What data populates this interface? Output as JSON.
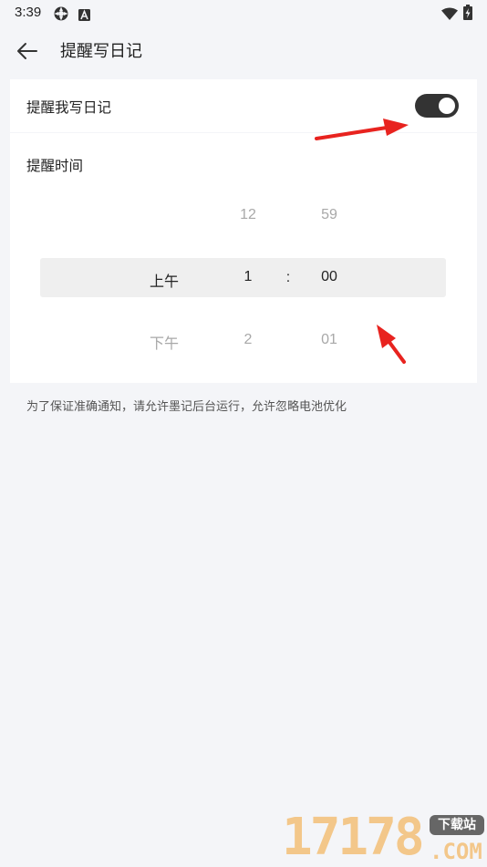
{
  "status_bar": {
    "time": "3:39",
    "icons": [
      "settings-gear-icon",
      "text-a-icon",
      "wifi-icon",
      "battery-charging-icon"
    ]
  },
  "header": {
    "back_icon": "arrow-left-icon",
    "title": "提醒写日记"
  },
  "remind_toggle": {
    "label": "提醒我写日记",
    "enabled": true
  },
  "time_picker": {
    "label": "提醒时间",
    "ampm_above": "",
    "ampm": "上午",
    "ampm_below": "下午",
    "hour_above": "12",
    "hour": "1",
    "hour_below": "2",
    "separator": ":",
    "minute_above": "59",
    "minute": "00",
    "minute_below": "01"
  },
  "hint": "为了保证准确通知，请允许墨记后台运行，允许忽略电池优化",
  "watermark": {
    "digits": "17178",
    "badge": "下载站",
    "suffix": ".COM"
  },
  "colors": {
    "background": "#f4f5f8",
    "card": "#ffffff",
    "toggle_on": "#333333",
    "annotation_arrow": "#e8231f",
    "watermark": "#f3c78a"
  }
}
